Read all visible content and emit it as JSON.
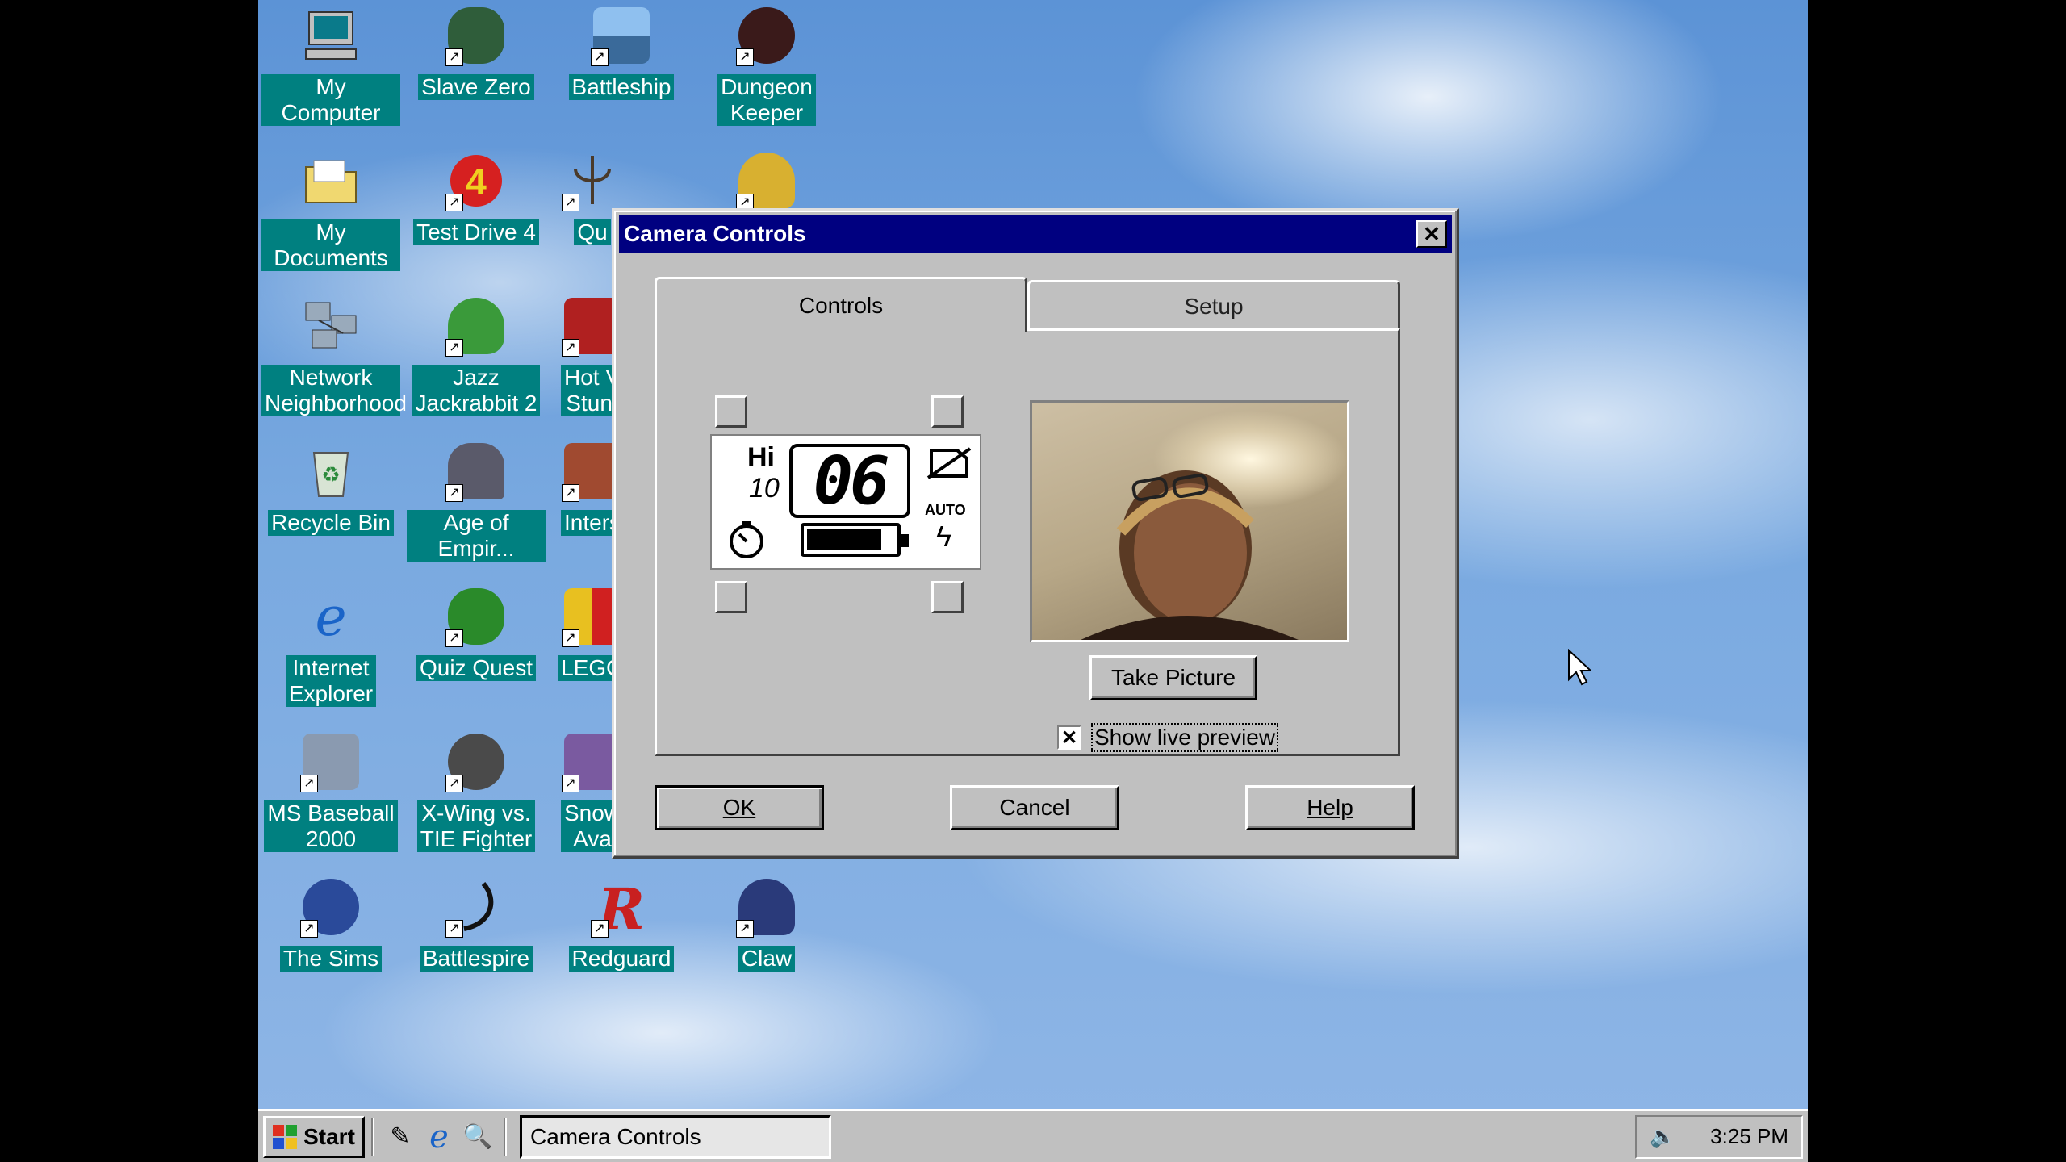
{
  "desktop": {
    "icons": [
      {
        "label": "My Computer",
        "icon": "computer-icon",
        "color": "#9aa4ad"
      },
      {
        "label": "Slave Zero",
        "icon": "robot-head-icon",
        "color": "#2f5d3a"
      },
      {
        "label": "Battleship",
        "icon": "ship-icon",
        "color": "#5a6f8a"
      },
      {
        "label": "Dungeon\nKeeper",
        "icon": "demon-icon",
        "color": "#3a1a1a"
      },
      {
        "label": "My Documents",
        "icon": "folder-icon",
        "color": "#e8d070"
      },
      {
        "label": "Test Drive 4",
        "icon": "test-drive-icon",
        "color": "#d62020"
      },
      {
        "label": "Qu",
        "icon": "quake-icon",
        "color": "#6b5a3a"
      },
      {
        "label": "Network\nNeighborhood",
        "icon": "network-icon",
        "color": "#4a6fa5"
      },
      {
        "label": "Jazz\nJackrabbit 2",
        "icon": "rabbit-icon",
        "color": "#3a9a3a"
      },
      {
        "label": "Hot V\nStunt",
        "icon": "hot-wheels-icon",
        "color": "#b02020"
      },
      {
        "label": "Recycle Bin",
        "icon": "recycle-bin-icon",
        "color": "#b8c8b0"
      },
      {
        "label": "Age of Empir...",
        "icon": "helmet-icon",
        "color": "#5a5a6a"
      },
      {
        "label": "Inters",
        "icon": "interstate-icon",
        "color": "#a04a30"
      },
      {
        "label": "Internet\nExplorer",
        "icon": "ie-icon",
        "color": "#1a64c8"
      },
      {
        "label": "Quiz Quest",
        "icon": "alien-icon",
        "color": "#2a8a2a"
      },
      {
        "label": "LEGO",
        "icon": "lego-icon",
        "color": "#e8c020"
      },
      {
        "label": "MS Baseball\n2000",
        "icon": "baseball-icon",
        "color": "#8a9ab0"
      },
      {
        "label": "X-Wing vs.\nTIE Fighter",
        "icon": "xwing-icon",
        "color": "#4a4a4a"
      },
      {
        "label": "Snow\nAva",
        "icon": "snowboard-icon",
        "color": "#7a5aa0"
      },
      {
        "label": "The Sims",
        "icon": "sims-icon",
        "color": "#2a4a9a"
      },
      {
        "label": "Battlespire",
        "icon": "battlespire-icon",
        "color": "#cfcfcf"
      },
      {
        "label": "Redguard",
        "icon": "redguard-icon",
        "color": "#c82020"
      },
      {
        "label": "Claw",
        "icon": "claw-icon",
        "color": "#2a3a7a"
      }
    ]
  },
  "dialog": {
    "title": "Camera Controls",
    "close_glyph": "✕",
    "tabs": [
      {
        "label": "Controls",
        "active": true
      },
      {
        "label": "Setup",
        "active": false
      }
    ],
    "lcd": {
      "quality": "Hi",
      "resolution": "10",
      "count": "06",
      "flash_mode": "AUTO",
      "flash_glyph": "ϟ",
      "battery_level": 0.85
    },
    "take_picture_label": "Take Picture",
    "live_preview": {
      "label": "Show live preview",
      "checked": true,
      "check_glyph": "✕"
    },
    "buttons": {
      "ok": "OK",
      "cancel": "Cancel",
      "help": "Help"
    }
  },
  "taskbar": {
    "start_label": "Start",
    "quick_launch": [
      {
        "icon": "edit-icon",
        "glyph": "✎"
      },
      {
        "icon": "ie-icon",
        "glyph": "e"
      },
      {
        "icon": "explorer-icon",
        "glyph": "🔍"
      }
    ],
    "active_task": "Camera Controls",
    "clock": "3:25 PM",
    "volume_glyph": "🔈"
  },
  "colors": {
    "titlebar": "#000080",
    "face": "#c0c0c0",
    "icon_label_bg": "#008080"
  }
}
